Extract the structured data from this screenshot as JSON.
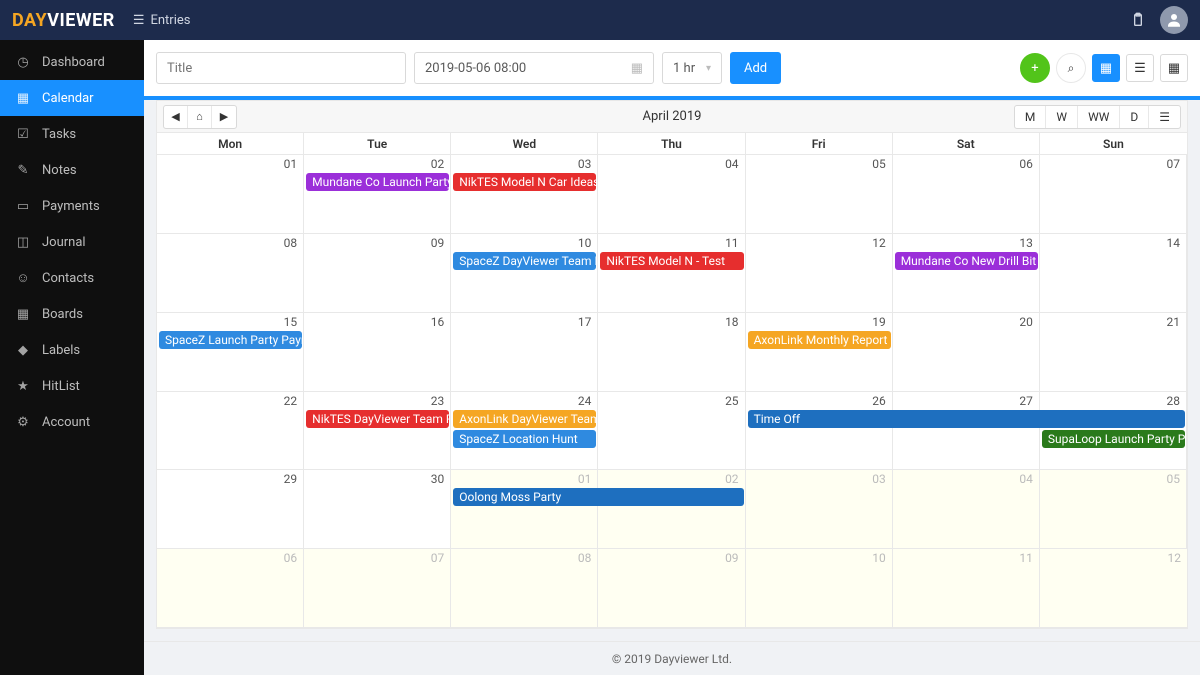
{
  "brand": {
    "day": "DAY",
    "viewer": "VIEWER"
  },
  "topbar": {
    "entries": "Entries"
  },
  "sidebar": {
    "items": [
      {
        "label": "Dashboard"
      },
      {
        "label": "Calendar"
      },
      {
        "label": "Tasks"
      },
      {
        "label": "Notes"
      },
      {
        "label": "Payments"
      },
      {
        "label": "Journal"
      },
      {
        "label": "Contacts"
      },
      {
        "label": "Boards"
      },
      {
        "label": "Labels"
      },
      {
        "label": "HitList"
      },
      {
        "label": "Account"
      }
    ]
  },
  "toolbar": {
    "title_placeholder": "Title",
    "date": "2019-05-06 08:00",
    "duration": "1 hr",
    "add": "Add"
  },
  "calendar": {
    "title": "April 2019",
    "views": [
      "M",
      "W",
      "WW",
      "D"
    ],
    "dow": [
      "Mon",
      "Tue",
      "Wed",
      "Thu",
      "Fri",
      "Sat",
      "Sun"
    ],
    "days": [
      [
        "01",
        "02",
        "03",
        "04",
        "05",
        "06",
        "07"
      ],
      [
        "08",
        "09",
        "10",
        "11",
        "12",
        "13",
        "14"
      ],
      [
        "15",
        "16",
        "17",
        "18",
        "19",
        "20",
        "21"
      ],
      [
        "22",
        "23",
        "24",
        "25",
        "26",
        "27",
        "28"
      ],
      [
        "29",
        "30",
        "01",
        "02",
        "03",
        "04",
        "05"
      ],
      [
        "06",
        "07",
        "08",
        "09",
        "10",
        "11",
        "12"
      ]
    ]
  },
  "events": {
    "w0": [
      {
        "label": "Mundane Co Launch Party …",
        "color": "#9b2fd9",
        "col": 1,
        "span": 1,
        "row": 0
      },
      {
        "label": "NikTES Model N Car Ideas",
        "color": "#e62e2e",
        "col": 2,
        "span": 1,
        "row": 0
      }
    ],
    "w1": [
      {
        "label": "SpaceZ DayViewer Team Ro…",
        "color": "#2f8ae0",
        "col": 2,
        "span": 1,
        "row": 0
      },
      {
        "label": "NikTES Model N - Test",
        "color": "#e62e2e",
        "col": 3,
        "span": 1,
        "row": 0
      },
      {
        "label": "Mundane Co New Drill Bit",
        "color": "#9b2fd9",
        "col": 5,
        "span": 1,
        "row": 0
      }
    ],
    "w2": [
      {
        "label": "SpaceZ Launch Party Paym…",
        "color": "#2f8ae0",
        "col": 0,
        "span": 1,
        "row": 0
      },
      {
        "label": "AxonLink Monthly Report",
        "color": "#f5a623",
        "col": 4,
        "span": 1,
        "row": 0
      }
    ],
    "w3": [
      {
        "label": "NikTES DayViewer Team Room",
        "color": "#e62e2e",
        "col": 1,
        "span": 1,
        "row": 0
      },
      {
        "label": "AxonLink DayViewer Team …",
        "color": "#f5a623",
        "col": 2,
        "span": 1,
        "row": 0
      },
      {
        "label": "SpaceZ Location Hunt",
        "color": "#2f8ae0",
        "col": 2,
        "span": 1,
        "row": 1
      },
      {
        "label": "Time Off",
        "color": "#1e6fbf",
        "col": 4,
        "span": 3,
        "row": 0
      },
      {
        "label": "SupaLoop Launch Party Pa…",
        "color": "#2a7a1b",
        "col": 6,
        "span": 1,
        "row": 1
      }
    ],
    "w4": [
      {
        "label": "Oolong Moss Party",
        "color": "#1e6fbf",
        "col": 2,
        "span": 2,
        "row": 0
      }
    ]
  },
  "footer": "© 2019 Dayviewer Ltd."
}
